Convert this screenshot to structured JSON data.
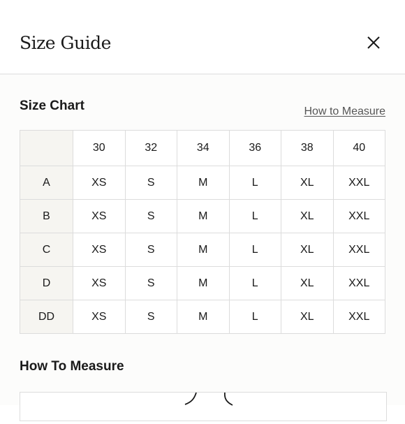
{
  "header": {
    "title": "Size Guide",
    "close_icon": "close-icon"
  },
  "size_chart": {
    "title": "Size Chart",
    "how_to_measure_link": "How to Measure",
    "columns": [
      "30",
      "32",
      "34",
      "36",
      "38",
      "40"
    ],
    "rows": [
      {
        "label": "A",
        "values": [
          "XS",
          "S",
          "M",
          "L",
          "XL",
          "XXL"
        ]
      },
      {
        "label": "B",
        "values": [
          "XS",
          "S",
          "M",
          "L",
          "XL",
          "XXL"
        ]
      },
      {
        "label": "C",
        "values": [
          "XS",
          "S",
          "M",
          "L",
          "XL",
          "XXL"
        ]
      },
      {
        "label": "D",
        "values": [
          "XS",
          "S",
          "M",
          "L",
          "XL",
          "XXL"
        ]
      },
      {
        "label": "DD",
        "values": [
          "XS",
          "S",
          "M",
          "L",
          "XL",
          "XXL"
        ]
      }
    ]
  },
  "how_to_measure": {
    "title": "How To Measure"
  }
}
